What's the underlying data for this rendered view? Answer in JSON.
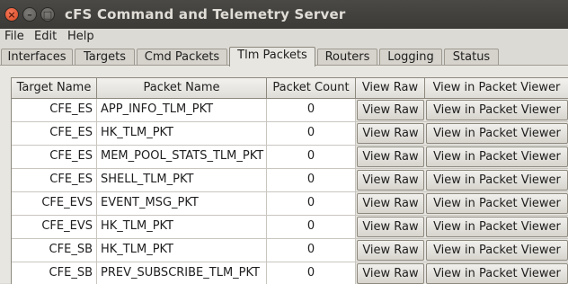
{
  "window": {
    "title": "cFS Command and Telemetry Server",
    "close_glyph": "×",
    "min_glyph": "–",
    "max_glyph": "□"
  },
  "menu": {
    "items": [
      "File",
      "Edit",
      "Help"
    ]
  },
  "tabs": [
    "Interfaces",
    "Targets",
    "Cmd Packets",
    "Tlm Packets",
    "Routers",
    "Logging",
    "Status"
  ],
  "active_tab": "Tlm Packets",
  "table": {
    "headers": [
      "Target Name",
      "Packet Name",
      "Packet Count",
      "View Raw",
      "View in Packet Viewer"
    ],
    "rows": [
      {
        "target": "CFE_ES",
        "packet": "APP_INFO_TLM_PKT",
        "count": "0",
        "raw": "View Raw",
        "viewer": "View in Packet Viewer"
      },
      {
        "target": "CFE_ES",
        "packet": "HK_TLM_PKT",
        "count": "0",
        "raw": "View Raw",
        "viewer": "View in Packet Viewer"
      },
      {
        "target": "CFE_ES",
        "packet": "MEM_POOL_STATS_TLM_PKT",
        "count": "0",
        "raw": "View Raw",
        "viewer": "View in Packet Viewer"
      },
      {
        "target": "CFE_ES",
        "packet": "SHELL_TLM_PKT",
        "count": "0",
        "raw": "View Raw",
        "viewer": "View in Packet Viewer"
      },
      {
        "target": "CFE_EVS",
        "packet": "EVENT_MSG_PKT",
        "count": "0",
        "raw": "View Raw",
        "viewer": "View in Packet Viewer"
      },
      {
        "target": "CFE_EVS",
        "packet": "HK_TLM_PKT",
        "count": "0",
        "raw": "View Raw",
        "viewer": "View in Packet Viewer"
      },
      {
        "target": "CFE_SB",
        "packet": "HK_TLM_PKT",
        "count": "0",
        "raw": "View Raw",
        "viewer": "View in Packet Viewer"
      },
      {
        "target": "CFE_SB",
        "packet": "PREV_SUBSCRIBE_TLM_PKT",
        "count": "0",
        "raw": "View Raw",
        "viewer": "View in Packet Viewer"
      }
    ]
  }
}
